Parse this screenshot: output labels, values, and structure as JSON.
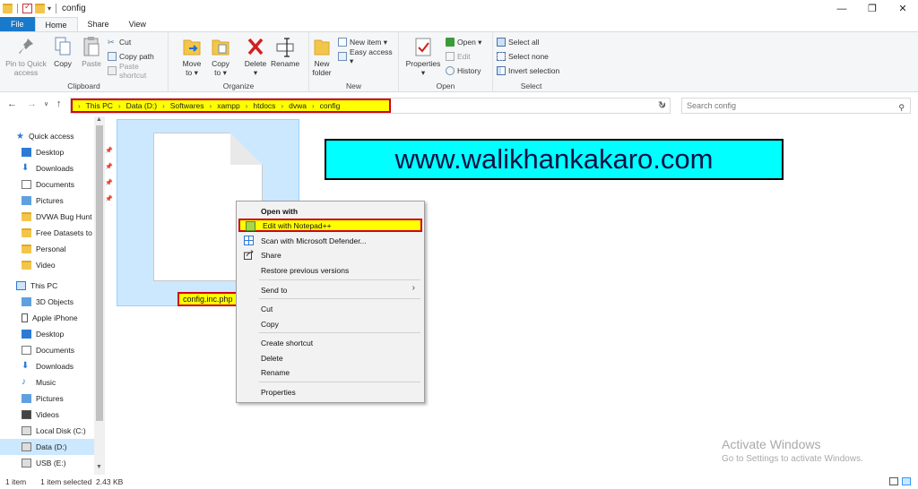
{
  "window": {
    "title": "config"
  },
  "tabs": [
    "File",
    "Home",
    "Share",
    "View"
  ],
  "ribbon": {
    "clipboard": {
      "label": "Clipboard",
      "pin_label": "Pin to Quick access",
      "copy_label": "Copy",
      "paste_label": "Paste",
      "cut_label": "Cut",
      "copy_path_label": "Copy path",
      "paste_shortcut_label": "Paste shortcut"
    },
    "organize": {
      "label": "Organize",
      "move_to_label": "Move to ▾",
      "copy_to_label": "Copy to ▾",
      "delete_label": "Delete ▾",
      "rename_label": "Rename"
    },
    "new": {
      "label": "New",
      "new_folder_label": "New folder",
      "new_item_label": "New item ▾",
      "easy_access_label": "Easy access ▾"
    },
    "open": {
      "label": "Open",
      "properties_label": "Properties ▾",
      "open_label": "Open ▾",
      "edit_label": "Edit",
      "history_label": "History"
    },
    "select": {
      "label": "Select",
      "select_all_label": "Select all",
      "select_none_label": "Select none",
      "invert_label": "Invert selection"
    }
  },
  "address": {
    "crumbs": [
      "This PC",
      "Data (D:)",
      "Softwares",
      "xampp",
      "htdocs",
      "dvwa",
      "config"
    ],
    "search_placeholder": "Search config"
  },
  "nav": {
    "quick_access": "Quick access",
    "quick_items": [
      "Desktop",
      "Downloads",
      "Documents",
      "Pictures",
      "DVWA Bug Hunt",
      "Free Datasets to",
      "Personal",
      "Video"
    ],
    "this_pc": "This PC",
    "pc_items": [
      "3D Objects",
      "Apple iPhone",
      "Desktop",
      "Documents",
      "Downloads",
      "Music",
      "Pictures",
      "Videos",
      "Local Disk (C:)",
      "Data (D:)",
      "USB (E:)"
    ]
  },
  "file": {
    "name": "config.inc.php"
  },
  "banner": {
    "text": "www.walikhankakaro.com"
  },
  "context_menu": {
    "open_with": "Open with",
    "edit_notepad": "Edit with Notepad++",
    "scan": "Scan with Microsoft Defender...",
    "share": "Share",
    "restore": "Restore previous versions",
    "send_to": "Send to",
    "cut": "Cut",
    "copy": "Copy",
    "create_shortcut": "Create shortcut",
    "delete": "Delete",
    "rename": "Rename",
    "properties": "Properties"
  },
  "watermark": {
    "title": "Activate Windows",
    "subtitle": "Go to Settings to activate Windows."
  },
  "status": {
    "item_count": "1 item",
    "selected": "1 item selected  2.43 KB"
  },
  "colors": {
    "accent": "#1979ca",
    "selection": "#cce8ff",
    "highlight": "#ffff00",
    "highlight_border": "#d0021b",
    "banner_bg": "#00ffff"
  }
}
